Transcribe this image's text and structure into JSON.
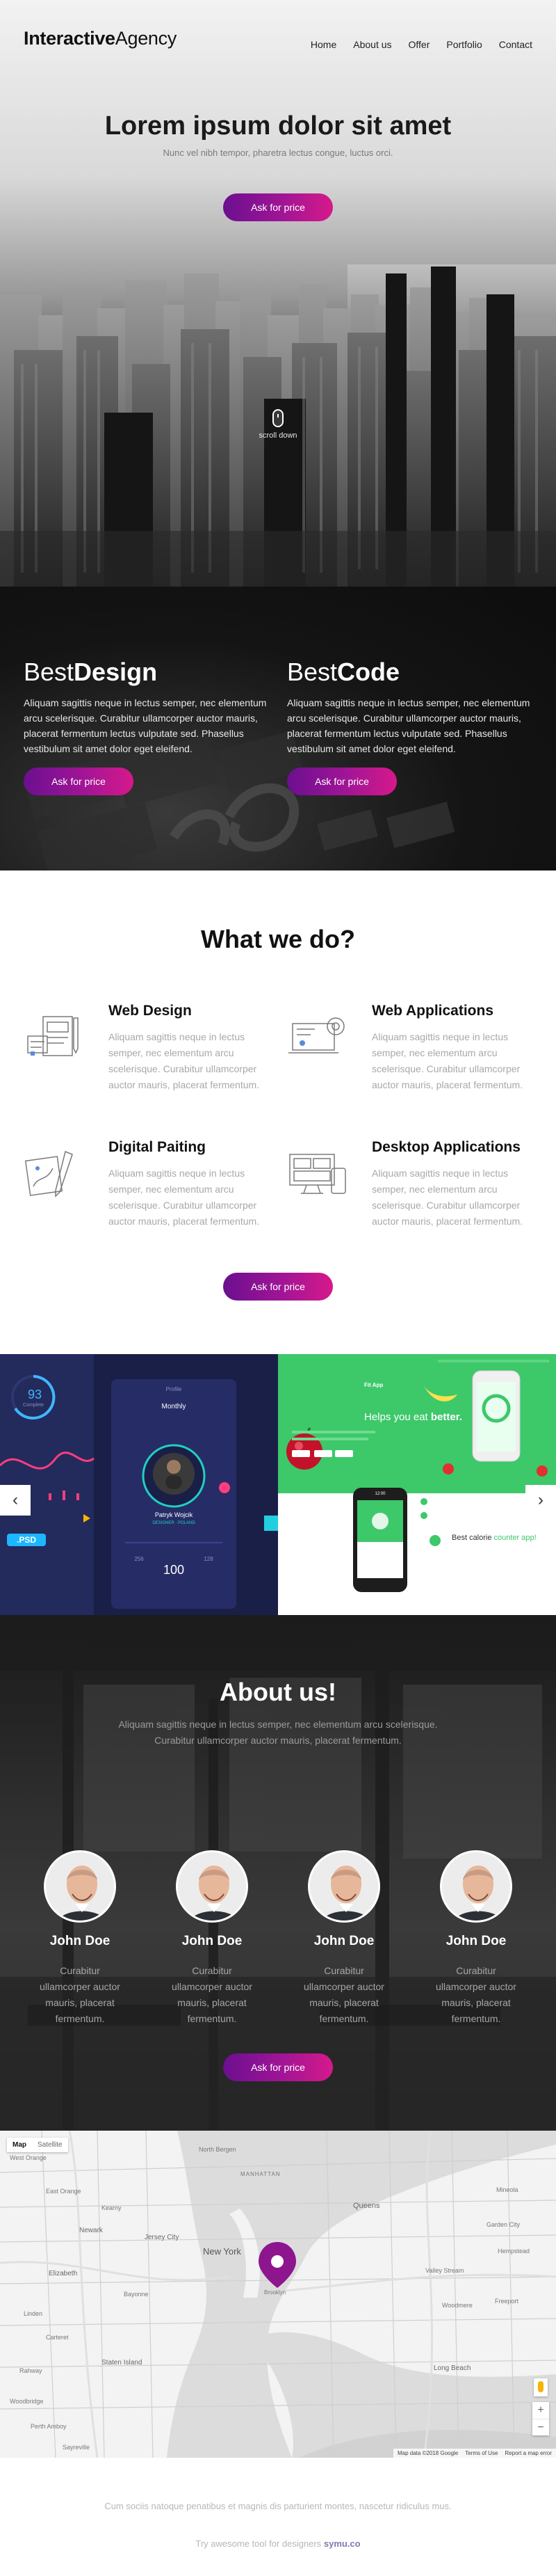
{
  "header": {
    "logo_bold": "Interactive",
    "logo_light": "Agency",
    "nav": [
      "Home",
      "About us",
      "Offer",
      "Portfolio",
      "Contact"
    ]
  },
  "hero": {
    "title": "Lorem ipsum dolor sit amet",
    "subtitle": "Nunc vel nibh tempor, pharetra lectus congue, luctus orci.",
    "button": "Ask for price",
    "scroll_label": "scroll down"
  },
  "best": [
    {
      "light": "Best",
      "bold": "Design",
      "text": "Aliquam sagittis neque in lectus semper, nec elementum arcu scelerisque. Curabitur ullamcorper auctor mauris, placerat fermentum lectus vulputate sed. Phasellus vestibulum sit amet dolor eget eleifend.",
      "button": "Ask for price"
    },
    {
      "light": "Best",
      "bold": "Code",
      "text": "Aliquam sagittis neque in lectus semper, nec elementum arcu scelerisque. Curabitur ullamcorper auctor mauris, placerat fermentum lectus vulputate sed. Phasellus vestibulum sit amet dolor eget eleifend.",
      "button": "Ask for price"
    }
  ],
  "services": {
    "title": "What we do?",
    "items": [
      {
        "title": "Web Design",
        "text": "Aliquam sagittis neque in lectus semper, nec elementum arcu scelerisque. Curabitur ullamcorper auctor mauris, placerat fermentum.",
        "icon": "web-design-icon"
      },
      {
        "title": "Web Applications",
        "text": "Aliquam sagittis neque in lectus semper, nec elementum arcu scelerisque. Curabitur ullamcorper auctor mauris, placerat fermentum.",
        "icon": "web-applications-icon"
      },
      {
        "title": "Digital Paiting",
        "text": "Aliquam sagittis neque in lectus semper, nec elementum arcu scelerisque. Curabitur ullamcorper auctor mauris, placerat fermentum.",
        "icon": "digital-painting-icon"
      },
      {
        "title": "Desktop Applications",
        "text": "Aliquam sagittis neque in lectus semper, nec elementum arcu scelerisque. Curabitur ullamcorper auctor mauris, placerat fermentum.",
        "icon": "desktop-applications-icon"
      }
    ],
    "button": "Ask for price"
  },
  "slider": {
    "left_arrow": "‹",
    "right_arrow": "›",
    "slide_a": {
      "progress_value": "93",
      "progress_caption": "Complete",
      "card_title": "Profile",
      "card_subtitle": "Monthly",
      "profile_name": "Patryk Wojcik",
      "profile_role": "DESIGNER · POLAND",
      "stat_number": "100",
      "stat_a": "256",
      "stat_b": "128",
      "badge": ".PSD"
    },
    "slide_b": {
      "app_name": "Fit App",
      "headline_plain": "Helps you eat ",
      "headline_bold": "better.",
      "card_plain": "Best calorie ",
      "card_accent": "counter app!",
      "phone_time": "12:00"
    }
  },
  "about": {
    "title": "About us!",
    "lead": "Aliquam sagittis neque in lectus semper, nec elementum arcu scelerisque. Curabitur ullamcorper auctor mauris, placerat fermentum.",
    "people": [
      {
        "name": "John Doe",
        "text": "Curabitur ullamcorper auctor mauris, placerat fermentum."
      },
      {
        "name": "John Doe",
        "text": "Curabitur ullamcorper auctor mauris, placerat fermentum."
      },
      {
        "name": "John Doe",
        "text": "Curabitur ullamcorper auctor mauris, placerat fermentum."
      },
      {
        "name": "John Doe",
        "text": "Curabitur ullamcorper auctor mauris, placerat fermentum."
      }
    ],
    "button": "Ask for price"
  },
  "map": {
    "type_map": "Map",
    "type_satellite": "Satellite",
    "labels": [
      "West Orange",
      "North Bergen",
      "East Orange",
      "MANHATTAN",
      "Queens",
      "Kearny",
      "Newark",
      "Jersey City",
      "New York",
      "Brooklyn",
      "Elizabeth",
      "Bayonne",
      "Staten Island",
      "Linden",
      "Carteret",
      "Mineola",
      "Garden City",
      "Hempstead",
      "Valley Stream",
      "Woodmere",
      "Long Beach",
      "Freeport",
      "Rahway",
      "Perth Amboy",
      "Woodbridge",
      "Sayreville"
    ],
    "attrib": [
      "Map data ©2018 Google",
      "Terms of Use",
      "Report a map error"
    ],
    "zoom_in": "+",
    "zoom_out": "−"
  },
  "footer": {
    "line1": "Cum sociis natoque penatibus et magnis dis parturient montes, nascetur ridiculus mus.",
    "line2_plain": "Try awesome tool for designers ",
    "line2_bold": "symu.co"
  },
  "colors": {
    "accent_start": "#6b0f8f",
    "accent_end": "#d6198a",
    "pin": "#8d168f",
    "green_slide": "#3dc86a",
    "navy_slide": "#1f2452"
  }
}
